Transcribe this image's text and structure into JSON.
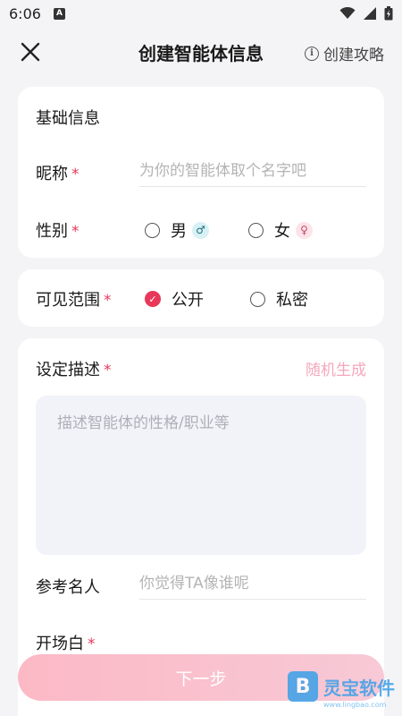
{
  "status_bar": {
    "time": "6:06",
    "notification": "A"
  },
  "header": {
    "title": "创建智能体信息",
    "guide_label": "创建攻略"
  },
  "basic_info": {
    "title": "基础信息",
    "nickname_label": "昵称",
    "nickname_placeholder": "为你的智能体取个名字吧",
    "gender_label": "性别",
    "gender_options": [
      {
        "label": "男",
        "symbol": "♂",
        "selected": false
      },
      {
        "label": "女",
        "symbol": "♀",
        "selected": false
      }
    ],
    "required_mark": "*"
  },
  "visibility": {
    "label": "可见范围",
    "options": [
      {
        "label": "公开",
        "selected": true
      },
      {
        "label": "私密",
        "selected": false
      }
    ]
  },
  "description": {
    "label": "设定描述",
    "random_label": "随机生成",
    "placeholder": "描述智能体的性格/职业等",
    "reference_label": "参考名人",
    "reference_placeholder": "你觉得TA像谁呢",
    "opening_label": "开场白"
  },
  "next_button": {
    "label": "下一步"
  },
  "watermark": {
    "text": "灵宝软件",
    "logo_letter": "B",
    "url_text": "www.lingbao.com"
  },
  "colors": {
    "accent": "#e8385a",
    "button": "#fbb9c5",
    "random_link": "#f4a8bc"
  }
}
